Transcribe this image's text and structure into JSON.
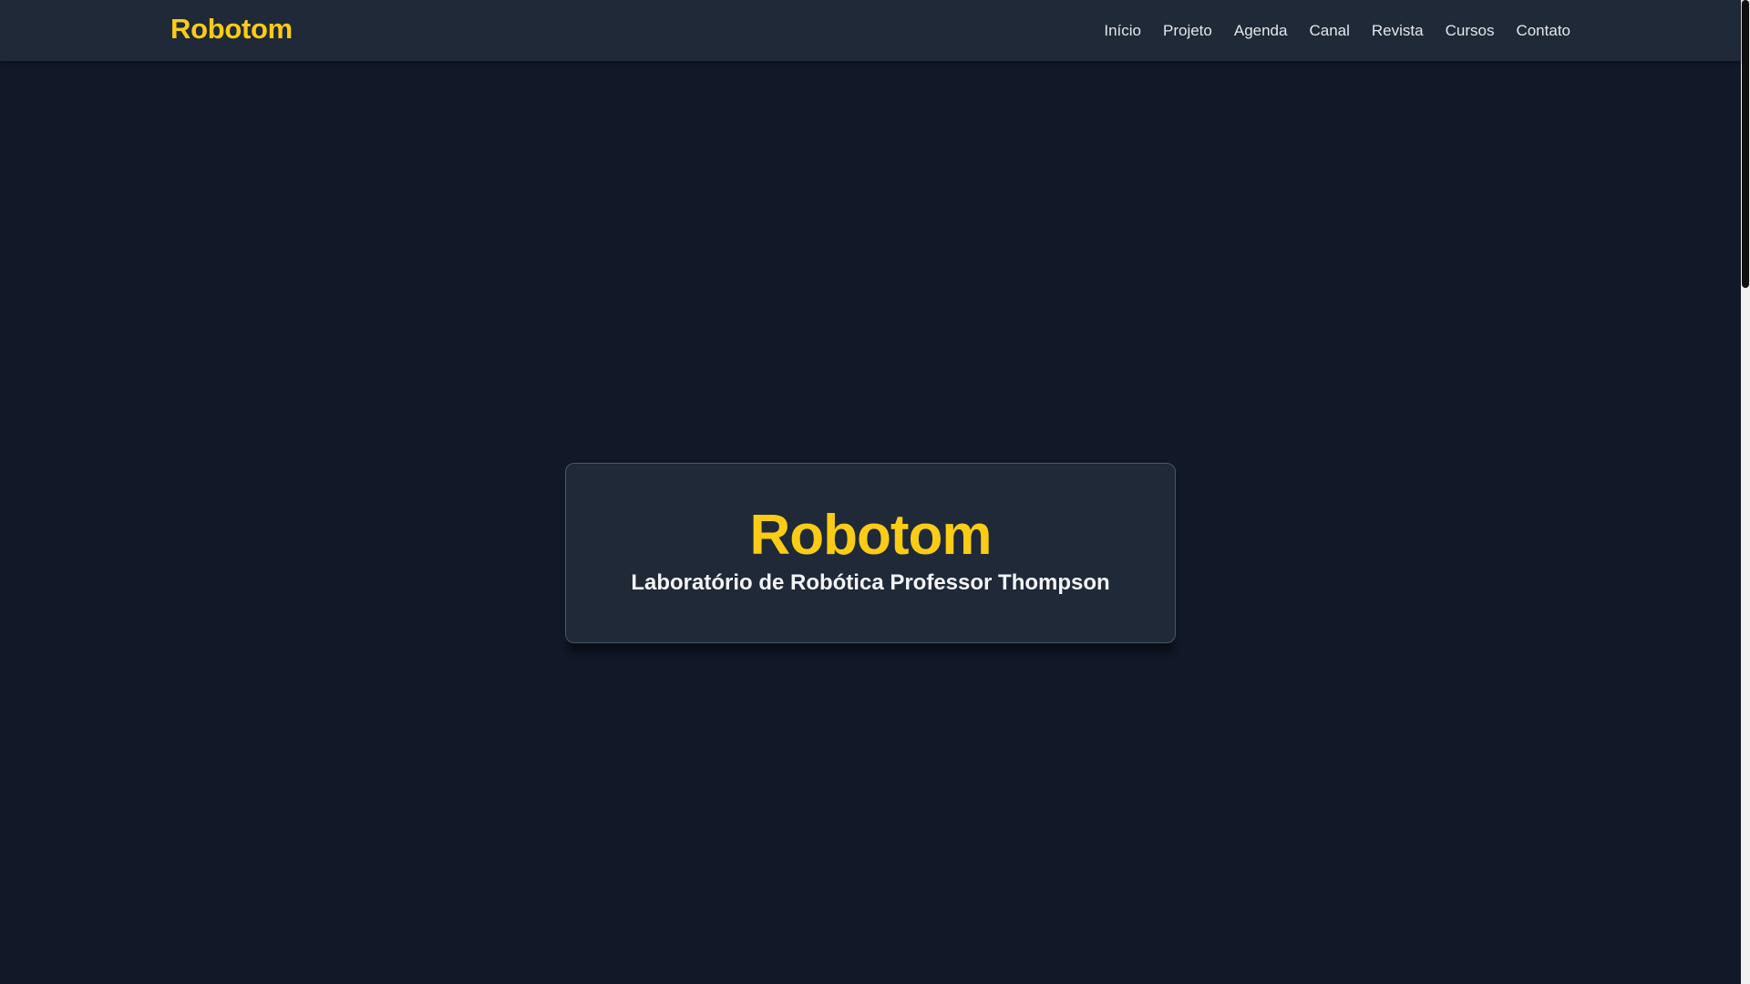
{
  "navbar": {
    "brand": "Robotom",
    "links": [
      {
        "label": "Início"
      },
      {
        "label": "Projeto"
      },
      {
        "label": "Agenda"
      },
      {
        "label": "Canal"
      },
      {
        "label": "Revista"
      },
      {
        "label": "Cursos"
      },
      {
        "label": "Contato"
      }
    ]
  },
  "hero": {
    "title": "Robotom",
    "subtitle": "Laboratório de Robótica Professor Thompson"
  },
  "colors": {
    "background": "#111827",
    "surface": "#1f2937",
    "accent": "#facc15",
    "text": "#e5e7eb"
  }
}
